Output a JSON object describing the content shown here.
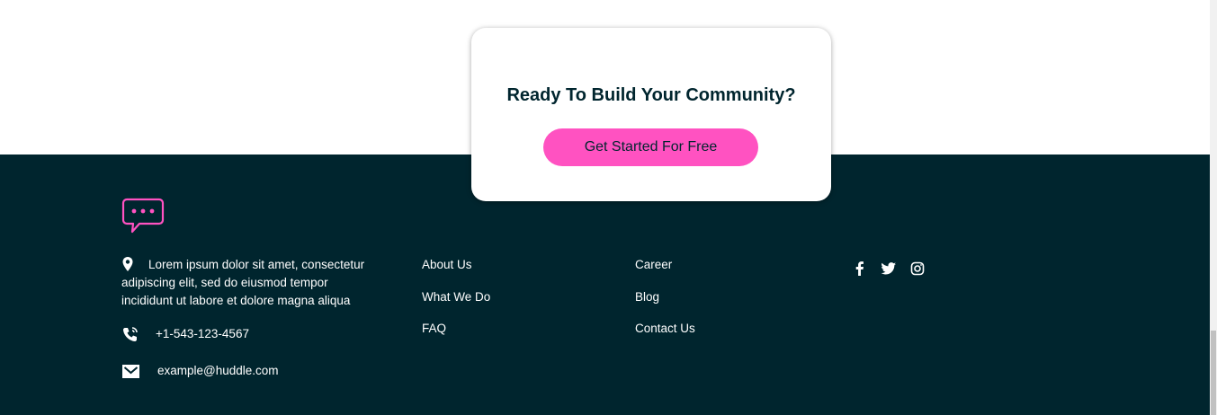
{
  "cta": {
    "title": "Ready To Build Your Community?",
    "button_label": "Get Started For Free"
  },
  "footer": {
    "address": "Lorem ipsum dolor sit amet, consectetur adipiscing elit, sed do eiusmod tempor incididunt ut labore et dolore magna aliqua",
    "phone": "+1-543-123-4567",
    "email": "example@huddle.com",
    "links_col1": [
      "About Us",
      "What We Do",
      "FAQ"
    ],
    "links_col2": [
      "Career",
      "Blog",
      "Contact Us"
    ],
    "social_icons": [
      "facebook-icon",
      "twitter-icon",
      "instagram-icon"
    ]
  },
  "colors": {
    "footer_bg": "#00252e",
    "accent_pink": "#ff52c1",
    "text_dark": "#00252e",
    "text_light": "#ffffff"
  }
}
